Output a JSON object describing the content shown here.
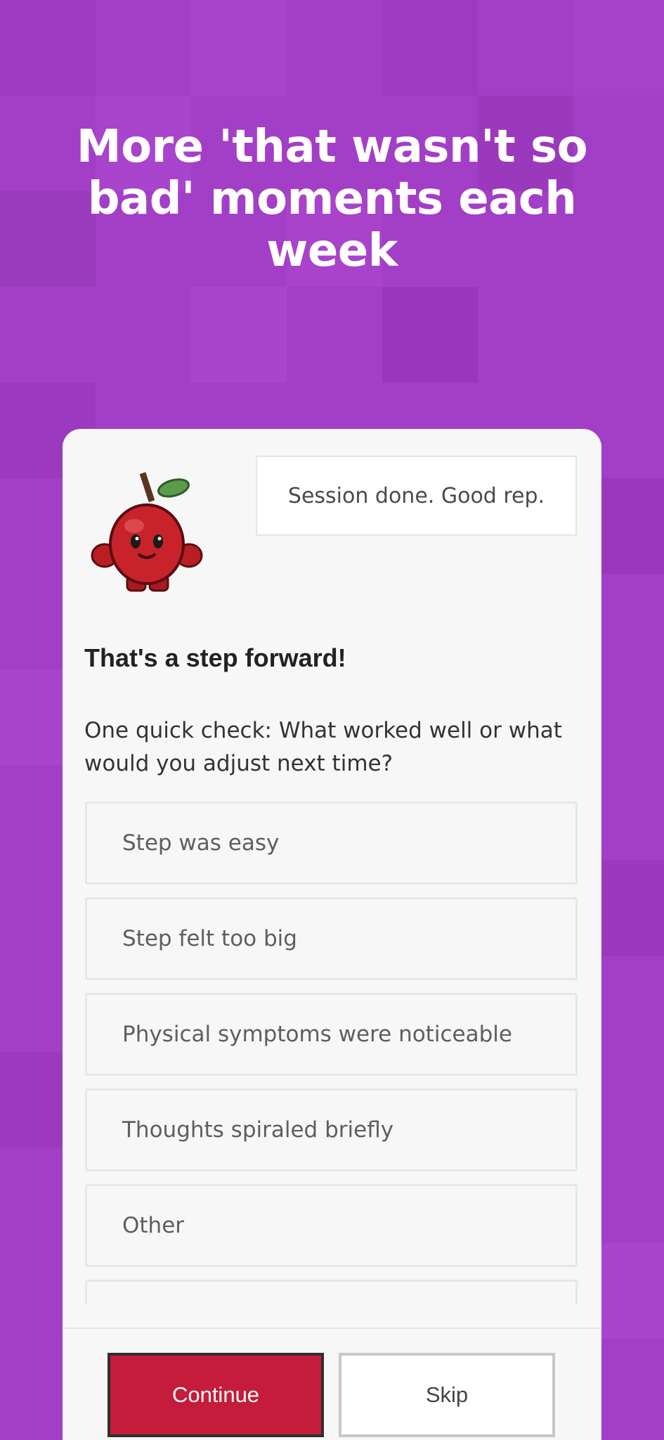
{
  "theme": {
    "background": "#a33ec6",
    "accent": "#c41c3a"
  },
  "headline": "More 'that wasn't so bad' moments each week",
  "card": {
    "mascot_icon": "apple-mascot-icon",
    "bubble_text": "Session done. Good rep.",
    "title": "That's a step forward!",
    "prompt": "One quick check: What worked well or what would you adjust next time?",
    "options": [
      "Step was easy",
      "Step felt too big",
      "Physical symptoms were noticeable",
      "Thoughts spiraled briefly",
      "Other"
    ]
  },
  "footer": {
    "continue_label": "Continue",
    "skip_label": "Skip"
  }
}
